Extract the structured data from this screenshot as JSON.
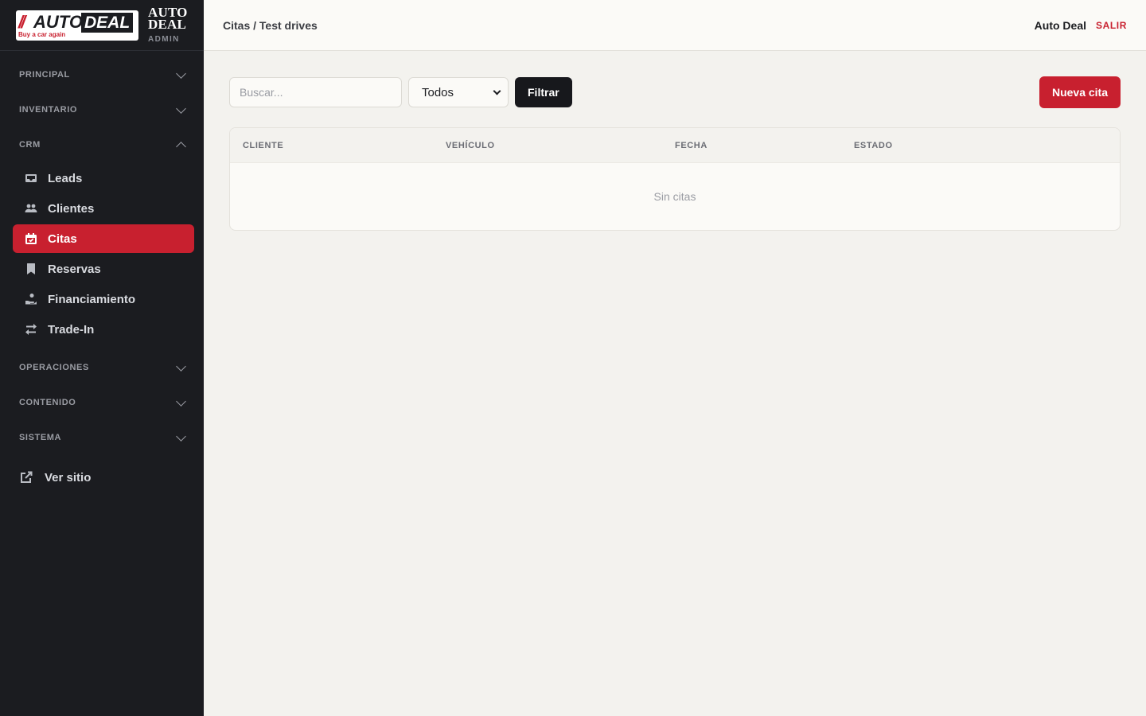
{
  "brand": {
    "logo_slashes": "//",
    "logo_auto": "AUTO",
    "logo_deal": "DEAL",
    "logo_tagline": "Buy a car again",
    "name_line1": "AUTO",
    "name_line2": "DEAL",
    "sub": "ADMIN"
  },
  "sidebar": {
    "sections": [
      {
        "label": "PRINCIPAL",
        "expanded": false
      },
      {
        "label": "INVENTARIO",
        "expanded": false
      },
      {
        "label": "CRM",
        "expanded": true
      },
      {
        "label": "OPERACIONES",
        "expanded": false
      },
      {
        "label": "CONTENIDO",
        "expanded": false
      },
      {
        "label": "SISTEMA",
        "expanded": false
      }
    ],
    "crm_items": [
      {
        "label": "Leads",
        "icon": "inbox-icon"
      },
      {
        "label": "Clientes",
        "icon": "users-icon"
      },
      {
        "label": "Citas",
        "icon": "calendar-icon",
        "active": true
      },
      {
        "label": "Reservas",
        "icon": "bookmark-icon"
      },
      {
        "label": "Financiamiento",
        "icon": "hand-coin-icon"
      },
      {
        "label": "Trade-In",
        "icon": "exchange-icon"
      }
    ],
    "view_site": "Ver sitio"
  },
  "topbar": {
    "breadcrumb": "Citas / Test drives",
    "user": "Auto Deal",
    "logout": "SALIR"
  },
  "toolbar": {
    "search_placeholder": "Buscar...",
    "status_select": "Todos",
    "filter_label": "Filtrar",
    "new_label": "Nueva cita"
  },
  "table": {
    "columns": [
      "CLIENTE",
      "VEHÍCULO",
      "FECHA",
      "ESTADO"
    ],
    "empty": "Sin citas"
  },
  "colors": {
    "accent": "#c8202f",
    "sidebar_bg": "#1b1c20",
    "page_bg": "#f3f2ee"
  }
}
